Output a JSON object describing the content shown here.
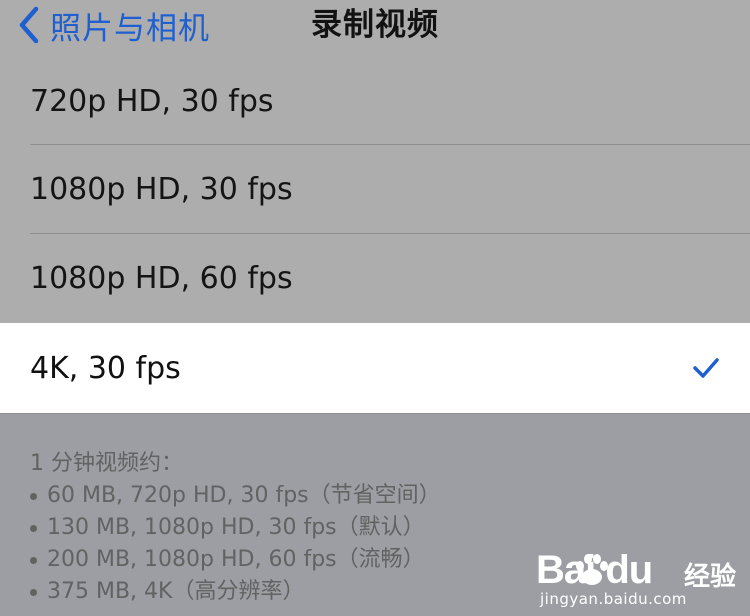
{
  "navbar": {
    "back_label": "照片与相机",
    "title": "录制视频"
  },
  "options": [
    {
      "label": "720p HD, 30 fps",
      "selected": false
    },
    {
      "label": "1080p HD, 30 fps",
      "selected": false
    },
    {
      "label": "1080p HD, 60 fps",
      "selected": false
    },
    {
      "label": "4K, 30 fps",
      "selected": true
    }
  ],
  "footer": {
    "heading": "1 分钟视频约：",
    "items": [
      "60 MB, 720p HD, 30 fps（节省空间）",
      "130 MB, 1080p HD, 30 fps（默认）",
      "200 MB, 1080p HD, 60 fps（流畅）",
      "375 MB, 4K（高分辨率）"
    ]
  },
  "watermark": {
    "brand": "Bai  du",
    "jingyan": "经验",
    "url": "jingyan.baidu.com"
  },
  "icons": {
    "back": "chevron-left-icon",
    "check": "checkmark-icon",
    "logo": "baidu-paw-icon"
  },
  "colors": {
    "accent": "#1f5fd0",
    "navbar_bg": "#adadad",
    "page_bg": "#9d9ea3",
    "selected_row_bg": "#ffffff"
  }
}
